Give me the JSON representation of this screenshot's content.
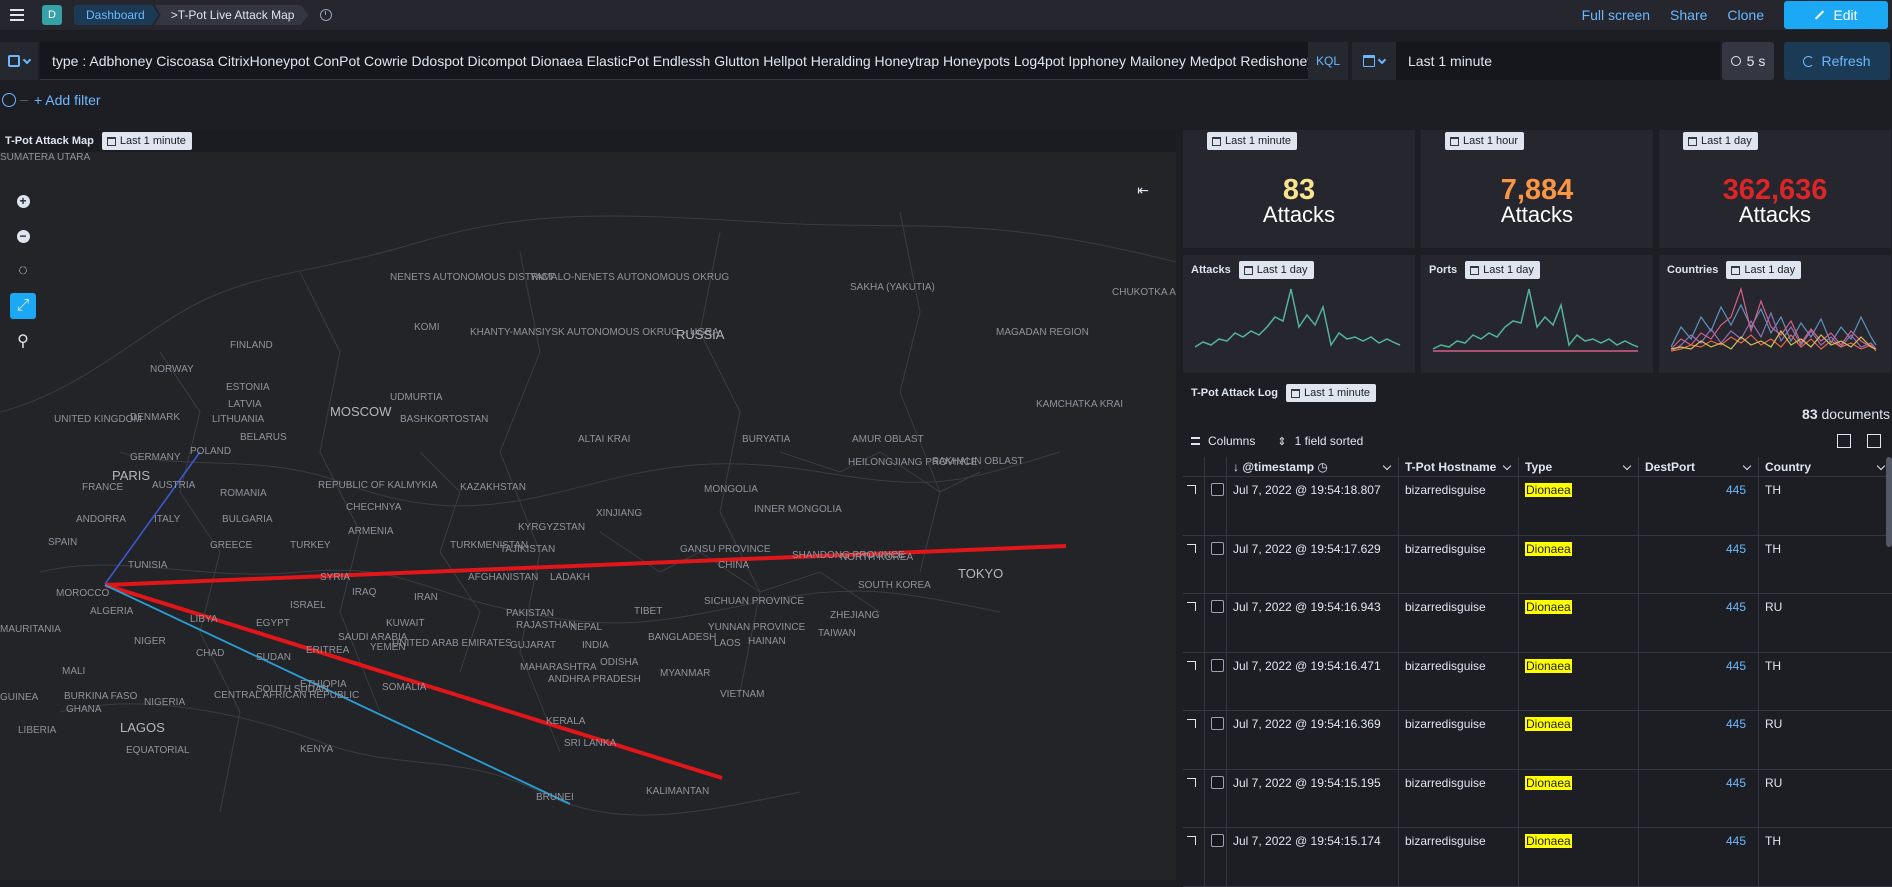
{
  "header": {
    "app_letter": "D",
    "breadcrumbs": [
      "Dashboard",
      ">T-Pot Live Attack Map"
    ],
    "actions": {
      "fullscreen": "Full screen",
      "share": "Share",
      "clone": "Clone",
      "edit": "Edit"
    }
  },
  "query": {
    "text": "type : Adbhoney Ciscoasa CitrixHoneypot ConPot Cowrie Ddospot Dicompot Dionaea ElasticPot Endlessh Glutton Hellpot Heralding Honeytrap Honeypots Log4pot Ipphoney Mailoney Medpot Redishoneypot Tanner",
    "language": "KQL",
    "time_range": "Last 1 minute",
    "refresh_interval": "5 s",
    "refresh_label": "Refresh"
  },
  "filters": {
    "add_label": "+ Add filter"
  },
  "map_panel": {
    "title": "T-Pot Attack Map",
    "time_badge": "Last 1 minute",
    "tools": [
      "zoom-in-icon",
      "zoom-out-icon",
      "locate-icon",
      "draw-line-icon",
      "tools-icon"
    ],
    "labels": [
      "NENETS AUTONOMOUS DISTRICT",
      "YAMALO-NENETS AUTONOMOUS OKRUG",
      "SAKHA (YAKUTIA)",
      "CHUKOTKA AUTONOMOUS OKRUG",
      "RUSSIA",
      "MAGADAN REGION",
      "KAMCHATKA KRAI",
      "KOMI",
      "FINLAND",
      "NORWAY",
      "ESTONIA",
      "LATVIA",
      "LITHUANIA",
      "BELARUS",
      "UDMURTIA",
      "MOSCOW",
      "BASHKORTOSTAN",
      "KHANTY-MANSIYSK AUTONOMOUS OKRUG – UGRA",
      "UNITED KINGDOM",
      "DENMARK",
      "GERMANY",
      "POLAND",
      "PARIS",
      "FRANCE",
      "AUSTRIA",
      "ROMANIA",
      "BULGARIA",
      "ANDORRA",
      "SPAIN",
      "ITALY",
      "GREECE",
      "TURKEY",
      "SYRIA",
      "IRAQ",
      "ISRAEL",
      "KUWAIT",
      "SAUDI ARABIA",
      "UNITED ARAB EMIRATES",
      "IRAN",
      "REPUBLIC OF KALMYKIA",
      "CHECHNYA",
      "ARMENIA",
      "KAZAKHSTAN",
      "ALTAI KRAI",
      "BURYATIA",
      "AMUR OBLAST",
      "HEILONGJIANG PROVINCE",
      "SAKHALIN OBLAST",
      "MONGOLIA",
      "XINJIANG",
      "INNER MONGOLIA",
      "KYRGYZSTAN",
      "TAJIKISTAN",
      "TURKMENISTAN",
      "AFGHANISTAN",
      "PAKISTAN",
      "LADAKH",
      "NEPAL",
      "TIBET",
      "GANSU PROVINCE",
      "CHINA",
      "SHANDONG PROVINCE",
      "NORTH KOREA",
      "SOUTH KOREA",
      "TOKYO",
      "SICHUAN PROVINCE",
      "YUNNAN PROVINCE",
      "ZHEJIANG",
      "TAIWAN",
      "BANGLADESH",
      "INDIA",
      "GUJARAT",
      "RAJASTHAN",
      "MAHARASHTRA",
      "ODISHA",
      "ANDHRA PRADESH",
      "MYANMAR",
      "LAOS",
      "HAINAN",
      "VIETNAM",
      "KERALA",
      "SRI LANKA",
      "TUNISIA",
      "MOROCCO",
      "ALGERIA",
      "LIBYA",
      "EGYPT",
      "SUDAN",
      "SOUTH SUDAN",
      "ETHIOPIA",
      "ERITREA",
      "YEMEN",
      "SOMALIA",
      "CHAD",
      "NIGER",
      "NIGERIA",
      "MAURITANIA",
      "MALI",
      "BURKINA FASO",
      "GUINEA",
      "GHANA",
      "LIBERIA",
      "LAGOS",
      "CENTRAL AFRICAN REPUBLIC",
      "KENYA",
      "EQUATORIAL",
      "BRUNEI",
      "KALIMANTAN",
      "SUMATERA UTARA"
    ]
  },
  "metrics": [
    {
      "badge": "Last 1 minute",
      "value": "83",
      "label": "Attacks",
      "color": "#f8e48d"
    },
    {
      "badge": "Last 1 hour",
      "value": "7,884",
      "label": "Attacks",
      "color": "#f99543"
    },
    {
      "badge": "Last 1 day",
      "value": "362,636",
      "label": "Attacks",
      "color": "#dc2526"
    }
  ],
  "sparks": [
    {
      "title": "Attacks",
      "badge": "Last 1 day"
    },
    {
      "title": "Ports",
      "badge": "Last 1 day"
    },
    {
      "title": "Countries",
      "badge": "Last 1 day"
    }
  ],
  "log": {
    "title": "T-Pot Attack Log",
    "badge": "Last 1 minute",
    "doc_count": "83",
    "doc_suffix": "documents",
    "toolbar": {
      "columns": "Columns",
      "sorted": "1 field sorted"
    },
    "columns": [
      "@timestamp",
      "T-Pot Hostname",
      "Type",
      "DestPort",
      "Country"
    ],
    "rows": [
      {
        "timestamp": "Jul 7, 2022 @ 19:54:18.807",
        "host": "bizarredisguise",
        "type": "Dionaea",
        "port": "445",
        "country": "TH"
      },
      {
        "timestamp": "Jul 7, 2022 @ 19:54:17.629",
        "host": "bizarredisguise",
        "type": "Dionaea",
        "port": "445",
        "country": "TH"
      },
      {
        "timestamp": "Jul 7, 2022 @ 19:54:16.943",
        "host": "bizarredisguise",
        "type": "Dionaea",
        "port": "445",
        "country": "RU"
      },
      {
        "timestamp": "Jul 7, 2022 @ 19:54:16.471",
        "host": "bizarredisguise",
        "type": "Dionaea",
        "port": "445",
        "country": "TH"
      },
      {
        "timestamp": "Jul 7, 2022 @ 19:54:16.369",
        "host": "bizarredisguise",
        "type": "Dionaea",
        "port": "445",
        "country": "RU"
      },
      {
        "timestamp": "Jul 7, 2022 @ 19:54:15.195",
        "host": "bizarredisguise",
        "type": "Dionaea",
        "port": "445",
        "country": "RU"
      },
      {
        "timestamp": "Jul 7, 2022 @ 19:54:15.174",
        "host": "bizarredisguise",
        "type": "Dionaea",
        "port": "445",
        "country": "TH"
      }
    ]
  }
}
